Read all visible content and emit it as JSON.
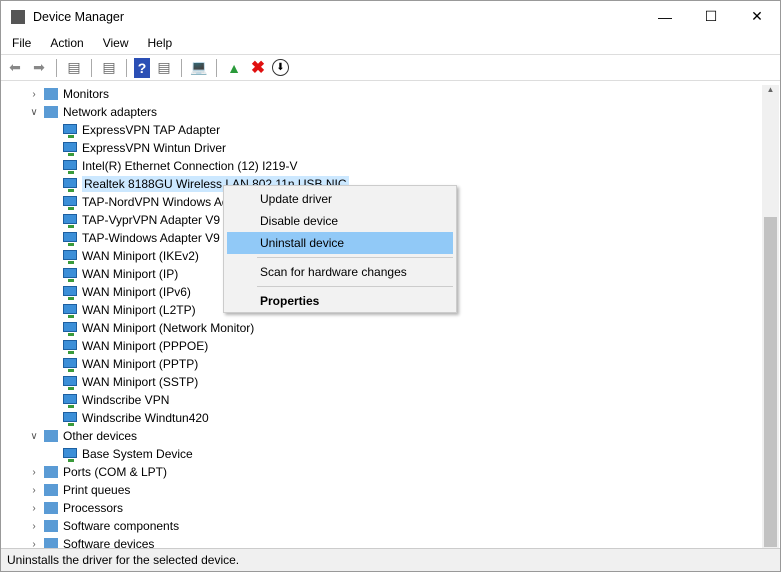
{
  "title": "Device Manager",
  "menu": [
    "File",
    "Action",
    "View",
    "Help"
  ],
  "toolbar": [
    "back-icon",
    "forward-icon",
    "show-hide-console-tree-icon",
    "properties-icon",
    "help-icon",
    "action-pane-icon",
    "scan-hardware-icon",
    "update-driver-icon",
    "uninstall-icon",
    "download-icon"
  ],
  "tree": [
    {
      "label": "Monitors",
      "level": 0,
      "exp": ">"
    },
    {
      "label": "Network adapters",
      "level": 0,
      "exp": "v"
    },
    {
      "label": "ExpressVPN TAP Adapter",
      "level": 1
    },
    {
      "label": "ExpressVPN Wintun Driver",
      "level": 1
    },
    {
      "label": "Intel(R) Ethernet Connection (12) I219-V",
      "level": 1
    },
    {
      "label": "Realtek 8188GU Wireless LAN 802.11n USB NIC",
      "level": 1,
      "selected": true
    },
    {
      "label": "TAP-NordVPN Windows Adapter V9",
      "level": 1
    },
    {
      "label": "TAP-VyprVPN Adapter V9",
      "level": 1
    },
    {
      "label": "TAP-Windows Adapter V9",
      "level": 1
    },
    {
      "label": "WAN Miniport (IKEv2)",
      "level": 1
    },
    {
      "label": "WAN Miniport (IP)",
      "level": 1
    },
    {
      "label": "WAN Miniport (IPv6)",
      "level": 1
    },
    {
      "label": "WAN Miniport (L2TP)",
      "level": 1
    },
    {
      "label": "WAN Miniport (Network Monitor)",
      "level": 1
    },
    {
      "label": "WAN Miniport (PPPOE)",
      "level": 1
    },
    {
      "label": "WAN Miniport (PPTP)",
      "level": 1
    },
    {
      "label": "WAN Miniport (SSTP)",
      "level": 1
    },
    {
      "label": "Windscribe VPN",
      "level": 1
    },
    {
      "label": "Windscribe Windtun420",
      "level": 1
    },
    {
      "label": "Other devices",
      "level": 0,
      "exp": "v"
    },
    {
      "label": "Base System Device",
      "level": 1
    },
    {
      "label": "Ports (COM & LPT)",
      "level": 0,
      "exp": ">"
    },
    {
      "label": "Print queues",
      "level": 0,
      "exp": ">"
    },
    {
      "label": "Processors",
      "level": 0,
      "exp": ">"
    },
    {
      "label": "Software components",
      "level": 0,
      "exp": ">"
    },
    {
      "label": "Software devices",
      "level": 0,
      "exp": ">"
    }
  ],
  "context_menu": {
    "update": "Update driver",
    "disable": "Disable device",
    "uninstall": "Uninstall device",
    "scan": "Scan for hardware changes",
    "properties": "Properties"
  },
  "status": "Uninstalls the driver for the selected device."
}
